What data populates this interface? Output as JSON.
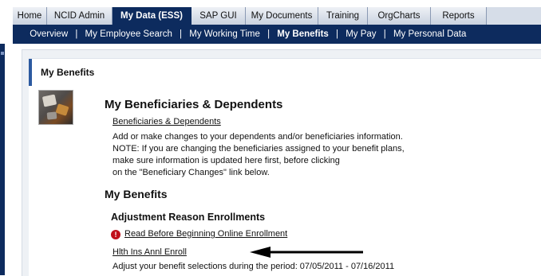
{
  "top_tabs": [
    {
      "label": "Home",
      "active": false
    },
    {
      "label": "NCID Admin",
      "active": false
    },
    {
      "label": "My Data (ESS)",
      "active": true
    },
    {
      "label": "SAP GUI",
      "active": false
    },
    {
      "label": "My Documents",
      "active": false
    },
    {
      "label": "Training",
      "active": false
    },
    {
      "label": "OrgCharts",
      "active": false
    },
    {
      "label": "Reports",
      "active": false
    }
  ],
  "sub_nav": [
    {
      "label": "Overview",
      "active": false
    },
    {
      "label": "My Employee Search",
      "active": false
    },
    {
      "label": "My Working Time",
      "active": false
    },
    {
      "label": "My Benefits",
      "active": true
    },
    {
      "label": "My Pay",
      "active": false
    },
    {
      "label": "My Personal Data",
      "active": false
    }
  ],
  "sub_nav_separator": "|",
  "panel": {
    "title": "My Benefits"
  },
  "beneficiaries_section": {
    "heading": "My Beneficiaries & Dependents",
    "link": "Beneficiaries & Dependents",
    "description_lines": [
      "Add or make changes to your dependents and/or beneficiaries information.",
      "NOTE:  If you are changing the beneficiaries assigned to your benefit plans,",
      "make sure information is updated here first, before clicking",
      "on the \"Beneficiary Changes\" link below."
    ]
  },
  "benefits_section": {
    "heading": "My Benefits",
    "subheading": "Adjustment Reason Enrollments",
    "warning_link": "Read Before Beginning Online Enrollment",
    "enroll_link": "Hlth Ins Annl Enroll",
    "period_text": "Adjust your benefit selections during the period: 07/05/2011 - 07/16/2011"
  },
  "colors": {
    "nav_dark": "#0d2b5e",
    "link": "#1a3fb5",
    "warning": "#c0101a"
  }
}
